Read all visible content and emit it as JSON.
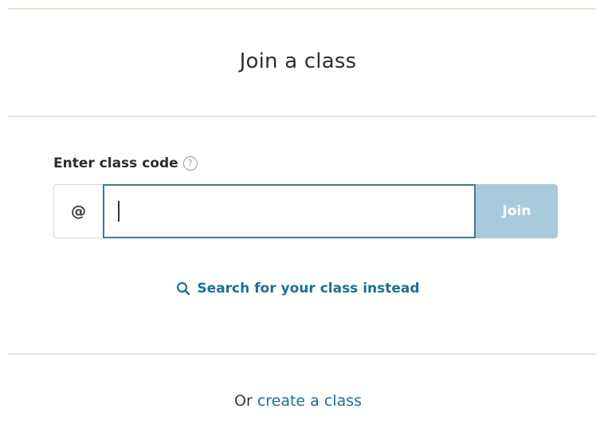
{
  "header": {
    "title": "Join a class"
  },
  "form": {
    "label": "Enter class code",
    "help_icon": "question-mark-circle-icon",
    "prefix": "@",
    "input_value": "",
    "input_placeholder": "",
    "join_label": "Join"
  },
  "search": {
    "icon": "search-icon",
    "label": "Search for your class instead"
  },
  "footer": {
    "prefix_text": "Or",
    "link_text": "create a class"
  },
  "colors": {
    "accent": "#1e6e93",
    "input_border": "#3f7a95",
    "join_button_bg": "#a8c9dc",
    "divider": "#e7e6d6"
  }
}
